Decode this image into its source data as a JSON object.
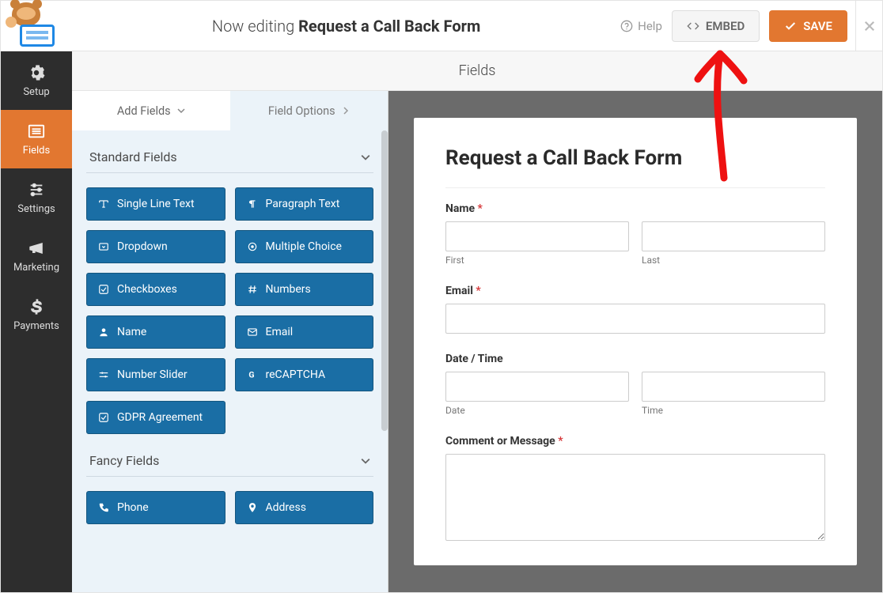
{
  "header": {
    "editing_prefix": "Now editing",
    "form_name": "Request a Call Back Form",
    "help_label": "Help",
    "embed_label": "EMBED",
    "save_label": "SAVE"
  },
  "sidenav": {
    "items": [
      {
        "id": "setup",
        "label": "Setup"
      },
      {
        "id": "fields",
        "label": "Fields"
      },
      {
        "id": "settings",
        "label": "Settings"
      },
      {
        "id": "marketing",
        "label": "Marketing"
      },
      {
        "id": "payments",
        "label": "Payments"
      }
    ],
    "active": "fields"
  },
  "section_title": "Fields",
  "left_panel": {
    "tabs": {
      "add_fields": "Add Fields",
      "field_options": "Field Options"
    },
    "groups": [
      {
        "title": "Standard Fields",
        "fields": [
          {
            "label": "Single Line Text",
            "icon": "text"
          },
          {
            "label": "Paragraph Text",
            "icon": "paragraph"
          },
          {
            "label": "Dropdown",
            "icon": "caret"
          },
          {
            "label": "Multiple Choice",
            "icon": "radio"
          },
          {
            "label": "Checkboxes",
            "icon": "check"
          },
          {
            "label": "Numbers",
            "icon": "hash"
          },
          {
            "label": "Name",
            "icon": "user"
          },
          {
            "label": "Email",
            "icon": "mail"
          },
          {
            "label": "Number Slider",
            "icon": "slider"
          },
          {
            "label": "reCAPTCHA",
            "icon": "g"
          },
          {
            "label": "GDPR Agreement",
            "icon": "check"
          }
        ]
      },
      {
        "title": "Fancy Fields",
        "fields": [
          {
            "label": "Phone",
            "icon": "phone"
          },
          {
            "label": "Address",
            "icon": "pin"
          }
        ]
      }
    ]
  },
  "preview": {
    "form_title": "Request a Call Back Form",
    "fields": [
      {
        "label": "Name",
        "required": true,
        "type": "name",
        "sub": [
          "First",
          "Last"
        ]
      },
      {
        "label": "Email",
        "required": true,
        "type": "text"
      },
      {
        "label": "Date / Time",
        "required": false,
        "type": "datetime",
        "sub": [
          "Date",
          "Time"
        ]
      },
      {
        "label": "Comment or Message",
        "required": true,
        "type": "textarea"
      }
    ]
  }
}
